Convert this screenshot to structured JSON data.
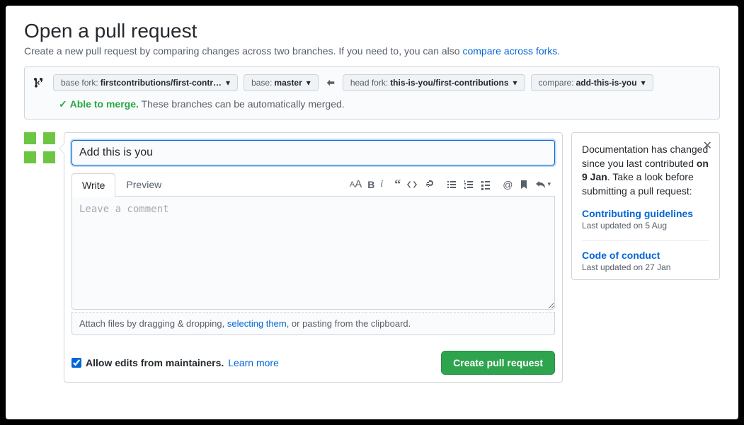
{
  "header": {
    "title": "Open a pull request",
    "subtitle_pre": "Create a new pull request by comparing changes across two branches. If you need to, you can also ",
    "subtitle_link": "compare across forks",
    "subtitle_post": "."
  },
  "compare": {
    "base_fork_label": "base fork:",
    "base_fork_value": "firstcontributions/first-contr…",
    "base_label": "base:",
    "base_value": "master",
    "head_fork_label": "head fork:",
    "head_fork_value": "this-is-you/first-contributions",
    "compare_label": "compare:",
    "compare_value": "add-this-is-you"
  },
  "merge": {
    "check": "✓",
    "able": "Able to merge.",
    "rest": "These branches can be automatically merged."
  },
  "form": {
    "title_value": "Add this is you",
    "tabs": {
      "write": "Write",
      "preview": "Preview"
    },
    "comment_placeholder": "Leave a comment",
    "attach_pre": "Attach files by dragging & dropping, ",
    "attach_link": "selecting them",
    "attach_post": ", or pasting from the clipboard.",
    "allow_edits": "Allow edits from maintainers.",
    "learn_more": "Learn more",
    "submit": "Create pull request"
  },
  "sidebar": {
    "text_pre": "Documentation has changed since you last contributed ",
    "text_bold": "on 9 Jan",
    "text_post": ". Take a look before submitting a pull request:",
    "items": [
      {
        "title": "Contributing guidelines",
        "date": "Last updated on 5 Aug"
      },
      {
        "title": "Code of conduct",
        "date": "Last updated on 27 Jan"
      }
    ]
  }
}
